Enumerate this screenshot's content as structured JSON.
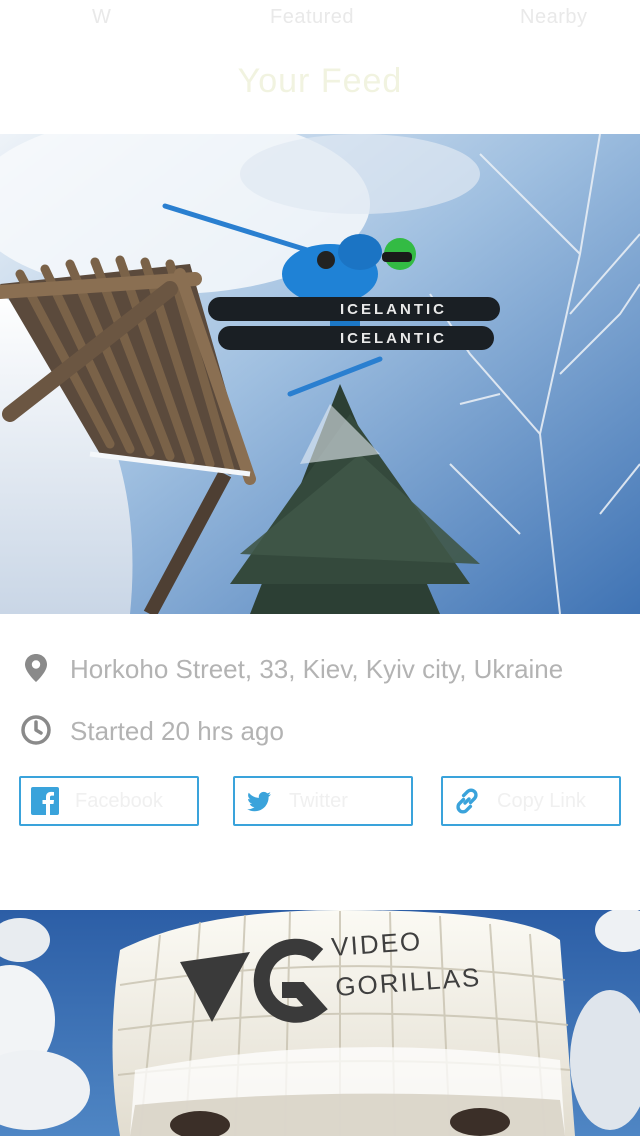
{
  "header": {
    "tab_left": "W",
    "tab_center": "Featured",
    "tab_right": "Nearby",
    "title": "Your Feed"
  },
  "post": {
    "image_icon": "ski-jump-photo",
    "location": "Horkoho Street, 33, Kiev, Kyiv city, Ukraine",
    "started": "Started 20 hrs ago",
    "ski_brand": "ICELANTIC"
  },
  "share": {
    "facebook_label": "Facebook",
    "twitter_label": "Twitter",
    "link_label": "Copy Link"
  },
  "next_post": {
    "image_icon": "hot-air-balloon-photo",
    "balloon_line1": "VIDEO",
    "balloon_line2": "GORILLAS"
  },
  "colors": {
    "accent": "#3aa3db",
    "muted_text": "#b3b3b3",
    "icon_gray": "#8a8a8a"
  }
}
